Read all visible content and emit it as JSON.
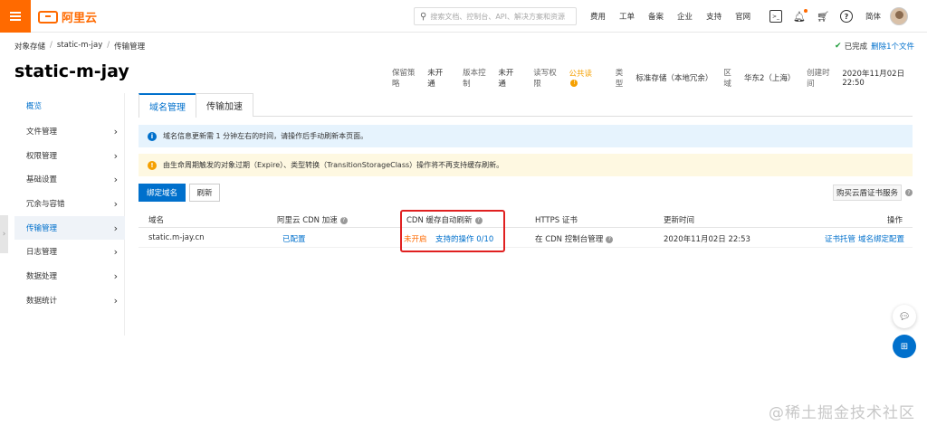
{
  "topbar": {
    "logo_text": "阿里云",
    "search_placeholder": "搜索文档、控制台、API、解决方案和资源",
    "nav": [
      "费用",
      "工单",
      "备案",
      "企业",
      "支持",
      "官网"
    ],
    "lang": "简体"
  },
  "breadcrumb": [
    "对象存储",
    "static-m-jay",
    "传输管理"
  ],
  "task_status": {
    "done": "已完成",
    "delete": "删除1个文件"
  },
  "page_title": "static-m-jay",
  "meta": [
    {
      "k": "保留策略",
      "v": "未开通"
    },
    {
      "k": "版本控制",
      "v": "未开通"
    },
    {
      "k": "读写权限",
      "v": "公共读"
    },
    {
      "k": "类型",
      "v": "标准存储（本地冗余）"
    },
    {
      "k": "区域",
      "v": "华东2（上海）"
    },
    {
      "k": "创建时间",
      "v": "2020年11月02日 22:50"
    }
  ],
  "sidebar": {
    "items": [
      {
        "label": "概览"
      },
      {
        "label": "文件管理"
      },
      {
        "label": "权限管理"
      },
      {
        "label": "基础设置"
      },
      {
        "label": "冗余与容错"
      },
      {
        "label": "传输管理"
      },
      {
        "label": "日志管理"
      },
      {
        "label": "数据处理"
      },
      {
        "label": "数据统计"
      }
    ]
  },
  "tabs": [
    "域名管理",
    "传输加速"
  ],
  "notices": {
    "info": "域名信息更新需 1 分钟左右的时间，请操作后手动刷新本页面。",
    "warn": "由生命周期触发的对象过期（Expire）、类型转换（TransitionStorageClass）操作将不再支持缓存刷新。"
  },
  "actions": {
    "bind_domain": "绑定域名",
    "refresh": "刷新",
    "buy_cert": "购买云盾证书服务"
  },
  "table": {
    "headers": [
      "域名",
      "阿里云 CDN 加速",
      "CDN 缓存自动刷新",
      "HTTPS 证书",
      "更新时间",
      "操作"
    ],
    "row": {
      "domain": "static.m-jay.cn",
      "cdn": "已配置",
      "refresh_status": "未开启",
      "supported_ops": "支持的操作 0/10",
      "https": "在 CDN 控制台管理",
      "updated": "2020年11月02日 22:53",
      "op1": "证书托管",
      "op2": "域名绑定配置"
    }
  },
  "watermark": "@稀土掘金技术社区",
  "colors": {
    "brand": "#ff6a00",
    "primary": "#0070cc",
    "highlight": "#e02020"
  }
}
